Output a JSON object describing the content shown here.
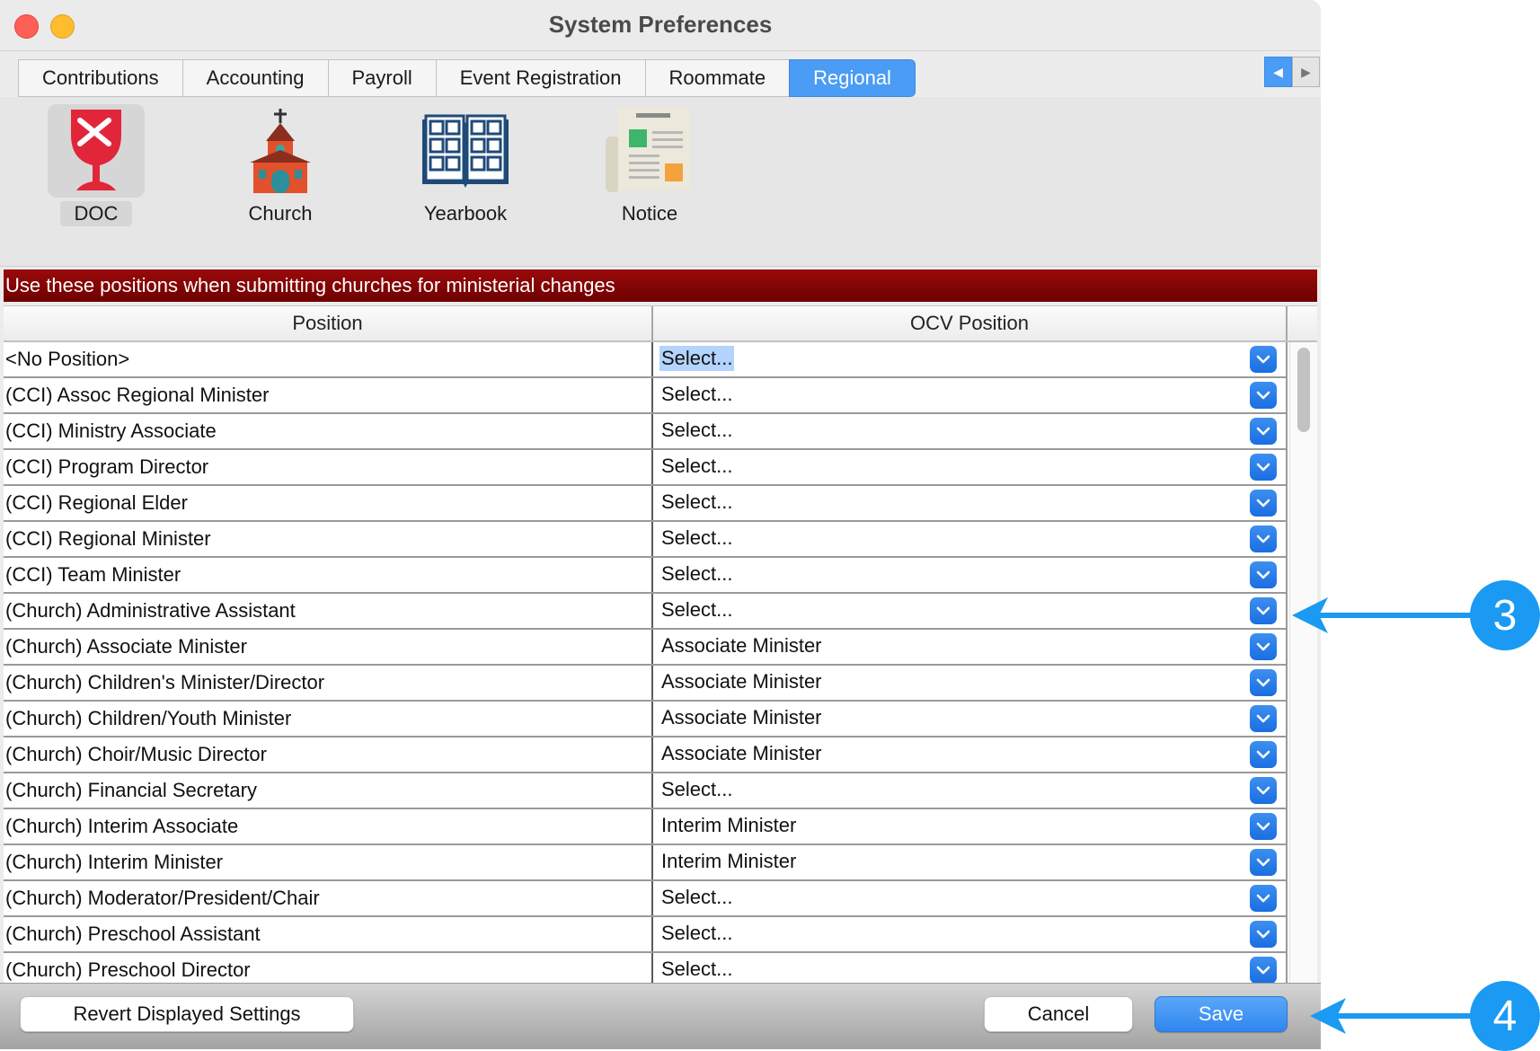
{
  "window": {
    "title": "System Preferences"
  },
  "tabs": [
    {
      "label": "Contributions",
      "active": false
    },
    {
      "label": "Accounting",
      "active": false
    },
    {
      "label": "Payroll",
      "active": false
    },
    {
      "label": "Event Registration",
      "active": false
    },
    {
      "label": "Roommate",
      "active": false
    },
    {
      "label": "Regional",
      "active": true
    }
  ],
  "icons": [
    {
      "label": "DOC",
      "icon": "chalice-icon",
      "selected": true
    },
    {
      "label": "Church",
      "icon": "church-building-icon",
      "selected": false
    },
    {
      "label": "Yearbook",
      "icon": "open-book-icon",
      "selected": false
    },
    {
      "label": "Notice",
      "icon": "newspaper-icon",
      "selected": false
    }
  ],
  "banner": {
    "text": "Use these positions when submitting churches for ministerial changes"
  },
  "table": {
    "columns": [
      "Position",
      "OCV Position"
    ],
    "rows": [
      {
        "position": "<No Position>",
        "ocv": "Select..."
      },
      {
        "position": "(CCI) Assoc Regional Minister",
        "ocv": "Select..."
      },
      {
        "position": "(CCI) Ministry Associate",
        "ocv": "Select..."
      },
      {
        "position": "(CCI) Program Director",
        "ocv": "Select..."
      },
      {
        "position": "(CCI) Regional Elder",
        "ocv": "Select..."
      },
      {
        "position": "(CCI) Regional Minister",
        "ocv": "Select..."
      },
      {
        "position": "(CCI) Team Minister",
        "ocv": "Select..."
      },
      {
        "position": "(Church) Administrative Assistant",
        "ocv": "Select..."
      },
      {
        "position": "(Church) Associate Minister",
        "ocv": "Associate Minister"
      },
      {
        "position": "(Church) Children's Minister/Director",
        "ocv": "Associate Minister"
      },
      {
        "position": "(Church) Children/Youth Minister",
        "ocv": "Associate Minister"
      },
      {
        "position": "(Church) Choir/Music Director",
        "ocv": "Associate Minister"
      },
      {
        "position": "(Church) Financial Secretary",
        "ocv": "Select..."
      },
      {
        "position": "(Church) Interim Associate",
        "ocv": "Interim Minister"
      },
      {
        "position": "(Church) Interim Minister",
        "ocv": "Interim Minister"
      },
      {
        "position": "(Church) Moderator/President/Chair",
        "ocv": "Select..."
      },
      {
        "position": "(Church) Preschool Assistant",
        "ocv": "Select..."
      },
      {
        "position": "(Church) Preschool Director",
        "ocv": "Select..."
      }
    ]
  },
  "buttons": {
    "revert": "Revert Displayed Settings",
    "cancel": "Cancel",
    "save": "Save"
  },
  "callouts": [
    {
      "number": "3",
      "target": "OCV position dropdown"
    },
    {
      "number": "4",
      "target": "Save button"
    }
  ],
  "colors": {
    "accent": "#4a9cf5",
    "banner": "#7a0000",
    "callout": "#1a9af2"
  }
}
